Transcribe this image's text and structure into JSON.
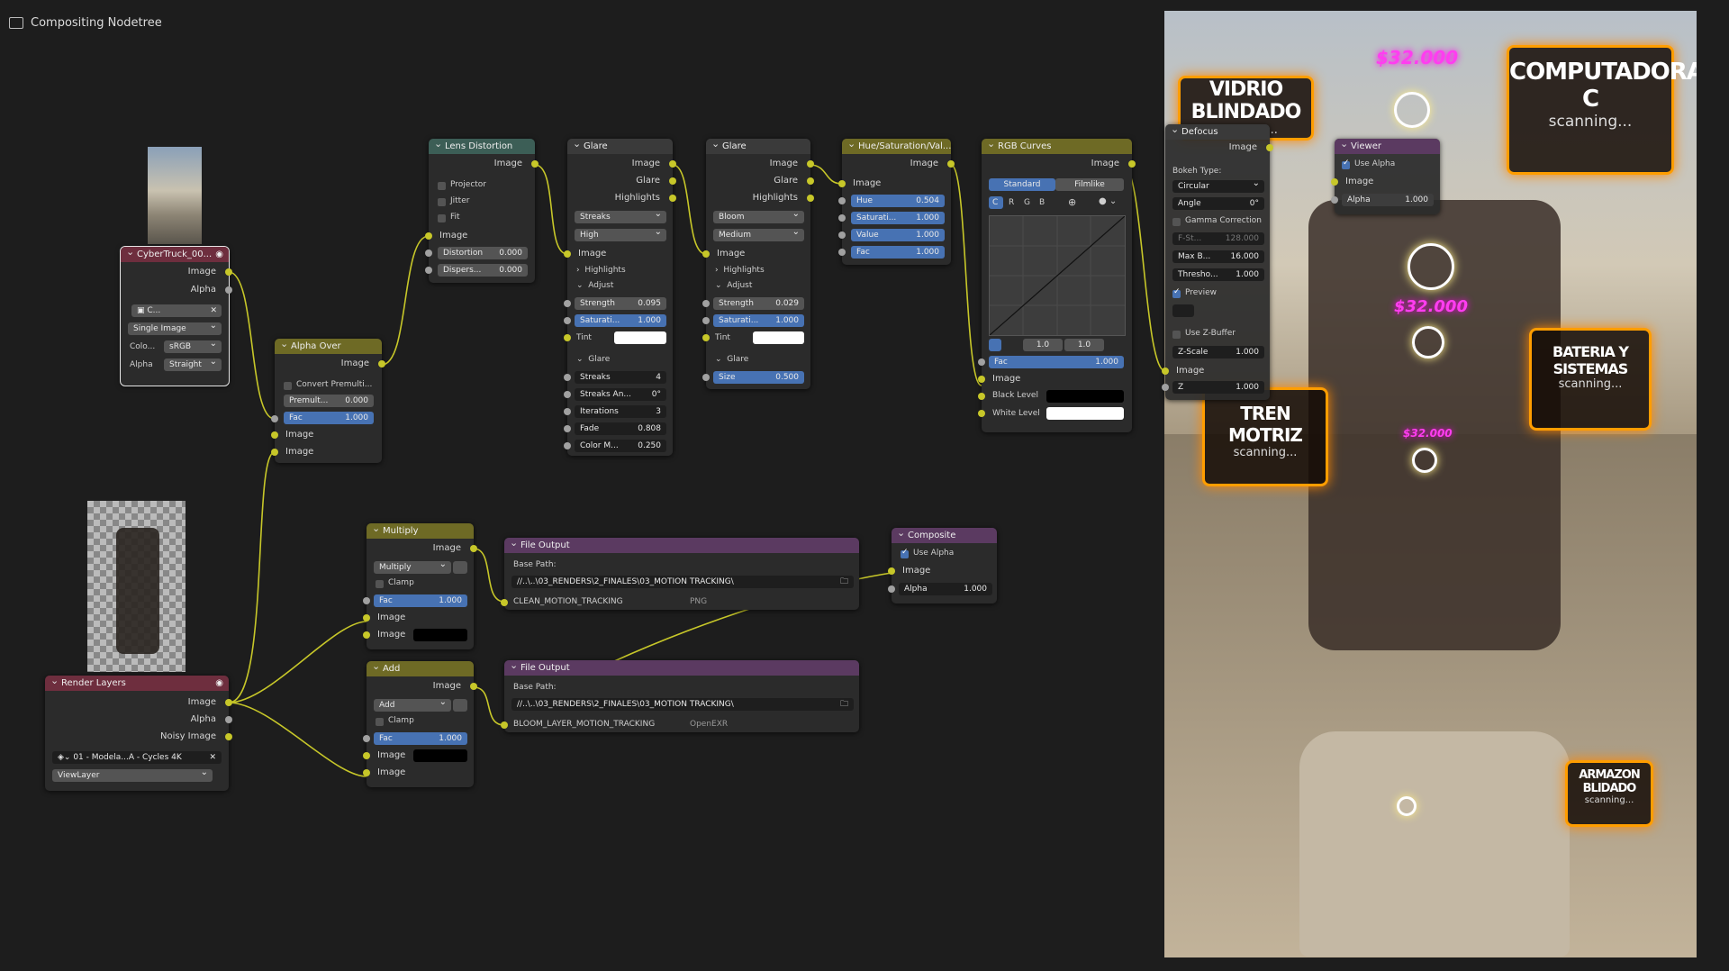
{
  "editor": {
    "title": "Compositing Nodetree"
  },
  "nodes": {
    "cybertruck": {
      "title": "CyberTruck_00...",
      "out_image": "Image",
      "out_alpha": "Alpha",
      "img_name": "C...",
      "source": "Single Image",
      "color_label": "Colo...",
      "color_value": "sRGB",
      "alpha_label": "Alpha",
      "alpha_value": "Straight"
    },
    "alpha_over": {
      "title": "Alpha Over",
      "out_image": "Image",
      "convert": "Convert Premulti...",
      "premul_label": "Premult...",
      "premul_value": "0.000",
      "fac_label": "Fac",
      "fac_value": "1.000",
      "in1": "Image",
      "in2": "Image"
    },
    "lens": {
      "title": "Lens Distortion",
      "out_image": "Image",
      "projector": "Projector",
      "jitter": "Jitter",
      "fit": "Fit",
      "in_image": "Image",
      "dist_label": "Distortion",
      "dist_value": "0.000",
      "disp_label": "Dispers...",
      "disp_value": "0.000"
    },
    "glare1": {
      "title": "Glare",
      "out_image": "Image",
      "out_glare": "Glare",
      "out_high": "Highlights",
      "type": "Streaks",
      "quality": "High",
      "in_image": "Image",
      "highlights": "Highlights",
      "adjust": "Adjust",
      "strength_label": "Strength",
      "strength_value": "0.095",
      "sat_label": "Saturati...",
      "sat_value": "1.000",
      "tint_label": "Tint",
      "glare_section": "Glare",
      "streaks_label": "Streaks",
      "streaks_value": "4",
      "angle_label": "Streaks An...",
      "angle_value": "0°",
      "iter_label": "Iterations",
      "iter_value": "3",
      "fade_label": "Fade",
      "fade_value": "0.808",
      "colm_label": "Color M...",
      "colm_value": "0.250"
    },
    "glare2": {
      "title": "Glare",
      "out_image": "Image",
      "out_glare": "Glare",
      "out_high": "Highlights",
      "type": "Bloom",
      "quality": "Medium",
      "in_image": "Image",
      "highlights": "Highlights",
      "adjust": "Adjust",
      "strength_label": "Strength",
      "strength_value": "0.029",
      "sat_label": "Saturati...",
      "sat_value": "1.000",
      "tint_label": "Tint",
      "glare_section": "Glare",
      "size_label": "Size",
      "size_value": "0.500"
    },
    "hsv": {
      "title": "Hue/Saturation/Val...",
      "out_image": "Image",
      "in_image": "Image",
      "hue_label": "Hue",
      "hue_value": "0.504",
      "sat_label": "Saturati...",
      "sat_value": "1.000",
      "val_label": "Value",
      "val_value": "1.000",
      "fac_label": "Fac",
      "fac_value": "1.000"
    },
    "rgb": {
      "title": "RGB Curves",
      "out_image": "Image",
      "tab_standard": "Standard",
      "tab_filmlike": "Filmlike",
      "ch_c": "C",
      "ch_r": "R",
      "ch_g": "G",
      "ch_b": "B",
      "x_value": "1.0",
      "y_value": "1.0",
      "fac_label": "Fac",
      "fac_value": "1.000",
      "in_image": "Image",
      "black": "Black Level",
      "white": "White Level"
    },
    "defocus": {
      "title": "Defocus",
      "out_image": "Image",
      "bokeh_label": "Bokeh Type:",
      "bokeh_value": "Circular",
      "angle_label": "Angle",
      "angle_value": "0°",
      "gamma": "Gamma Correction",
      "fstop_label": "F-St...",
      "fstop_value": "128.000",
      "maxb_label": "Max B...",
      "maxb_value": "16.000",
      "thresh_label": "Thresho...",
      "thresh_value": "1.000",
      "preview": "Preview",
      "zbuf": "Use Z-Buffer",
      "zscale_label": "Z-Scale",
      "zscale_value": "1.000",
      "in_image": "Image",
      "z_label": "Z",
      "z_value": "1.000"
    },
    "viewer": {
      "title": "Viewer",
      "use_alpha": "Use Alpha",
      "in_image": "Image",
      "alpha_label": "Alpha",
      "alpha_value": "1.000"
    },
    "render_layers": {
      "title": "Render Layers",
      "out_image": "Image",
      "out_alpha": "Alpha",
      "out_noisy": "Noisy Image",
      "scene": "01 - Modela...A - Cycles 4K",
      "view_layer": "ViewLayer"
    },
    "multiply": {
      "title": "Multiply",
      "out_image": "Image",
      "blend": "Multiply",
      "clamp": "Clamp",
      "fac_label": "Fac",
      "fac_value": "1.000",
      "in1": "Image",
      "in2": "Image"
    },
    "add": {
      "title": "Add",
      "out_image": "Image",
      "blend": "Add",
      "clamp": "Clamp",
      "fac_label": "Fac",
      "fac_value": "1.000",
      "in1": "Image",
      "in2": "Image"
    },
    "file_out1": {
      "title": "File Output",
      "base_label": "Base Path:",
      "base_path": "//..\\..\\03_RENDERS\\2_FINALES\\03_MOTION TRACKING\\",
      "slot": "CLEAN_MOTION_TRACKING",
      "format": "PNG"
    },
    "file_out2": {
      "title": "File Output",
      "base_label": "Base Path:",
      "base_path": "//..\\..\\03_RENDERS\\2_FINALES\\03_MOTION TRACKING\\",
      "slot": "BLOOM_LAYER_MOTION_TRACKING",
      "format": "OpenEXR"
    },
    "composite": {
      "title": "Composite",
      "use_alpha": "Use Alpha",
      "in_image": "Image",
      "alpha_label": "Alpha",
      "alpha_value": "1.000"
    }
  },
  "viewport": {
    "labels": [
      {
        "title": "VIDRIO BLINDADO",
        "sub": "scanning..."
      },
      {
        "title": "COMPUTADORA C",
        "sub": "scanning..."
      },
      {
        "title": "BATERIA Y SISTEMAS",
        "sub": "scanning..."
      },
      {
        "title": "TREN MOTRIZ",
        "sub": "scanning..."
      },
      {
        "title": "ARMAZON BLIDADO",
        "sub": "scanning..."
      }
    ],
    "prices": [
      "$32.000",
      "$32.000",
      "$32.000"
    ]
  },
  "colors": {
    "accent": "#4772b3",
    "socket_image": "#c7c729",
    "socket_value": "#a1a1a1",
    "hud": "#ff9d00",
    "price": "#ff3df0"
  },
  "icons": [
    "compositor-icon",
    "eye-icon",
    "close-icon",
    "folder-icon",
    "image-icon",
    "zoom-icon"
  ]
}
